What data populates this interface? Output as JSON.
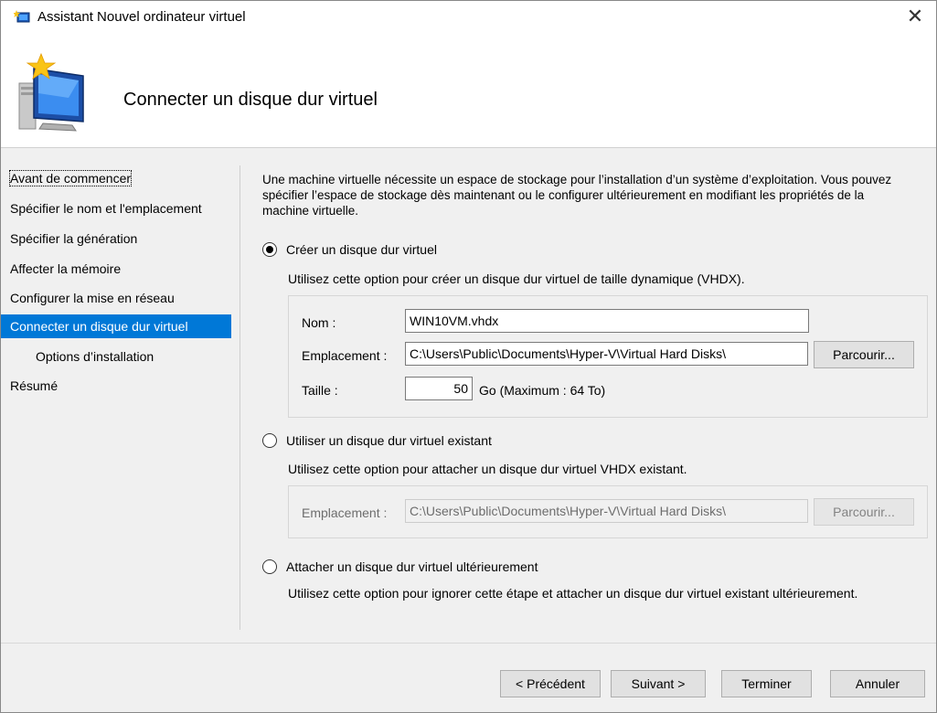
{
  "window": {
    "title": "Assistant Nouvel ordinateur virtuel",
    "close_glyph": "✕"
  },
  "header": {
    "page_title": "Connecter un disque dur virtuel"
  },
  "nav": {
    "items": [
      {
        "label": "Avant de commencer"
      },
      {
        "label": "Spécifier le nom et l'emplacement"
      },
      {
        "label": "Spécifier la génération"
      },
      {
        "label": "Affecter la mémoire"
      },
      {
        "label": "Configurer la mise en réseau"
      },
      {
        "label": "Connecter un disque dur virtuel"
      },
      {
        "label": "Options d’installation"
      },
      {
        "label": "Résumé"
      }
    ],
    "active_index": 5
  },
  "main": {
    "intro": "Une machine virtuelle nécessite un espace de stockage pour l’installation d’un système d’exploitation. Vous pouvez spécifier l’espace de stockage dès maintenant ou le configurer ultérieurement en modifiant les propriétés de la machine virtuelle.",
    "option_create": {
      "label": "Créer un disque dur virtuel",
      "selected": true,
      "description": "Utilisez cette option pour créer un disque dur virtuel de taille dynamique (VHDX).",
      "name_label": "Nom :",
      "name_value": "WIN10VM.vhdx",
      "location_label": "Emplacement :",
      "location_value": "C:\\Users\\Public\\Documents\\Hyper-V\\Virtual Hard Disks\\",
      "browse_label": "Parcourir...",
      "size_label": "Taille :",
      "size_value": "50",
      "size_unit": "Go (Maximum : 64 To)"
    },
    "option_existing": {
      "label": "Utiliser un disque dur virtuel existant",
      "selected": false,
      "description": "Utilisez cette option pour attacher un disque dur virtuel VHDX existant.",
      "location_label": "Emplacement :",
      "location_value": "C:\\Users\\Public\\Documents\\Hyper-V\\Virtual Hard Disks\\",
      "browse_label": "Parcourir..."
    },
    "option_later": {
      "label": "Attacher un disque dur virtuel ultérieurement",
      "selected": false,
      "description": "Utilisez cette option pour ignorer cette étape et attacher un disque dur virtuel existant ultérieurement."
    }
  },
  "footer": {
    "previous_label": "< Précédent",
    "next_label": "Suivant >",
    "finish_label": "Terminer",
    "cancel_label": "Annuler"
  },
  "colors": {
    "accent": "#0078d7",
    "window_bg": "#f0f0f0",
    "header_bg": "#ffffff"
  },
  "icons": {
    "app": "hyper-v-wizard-icon",
    "header": "new-virtual-machine-icon"
  }
}
